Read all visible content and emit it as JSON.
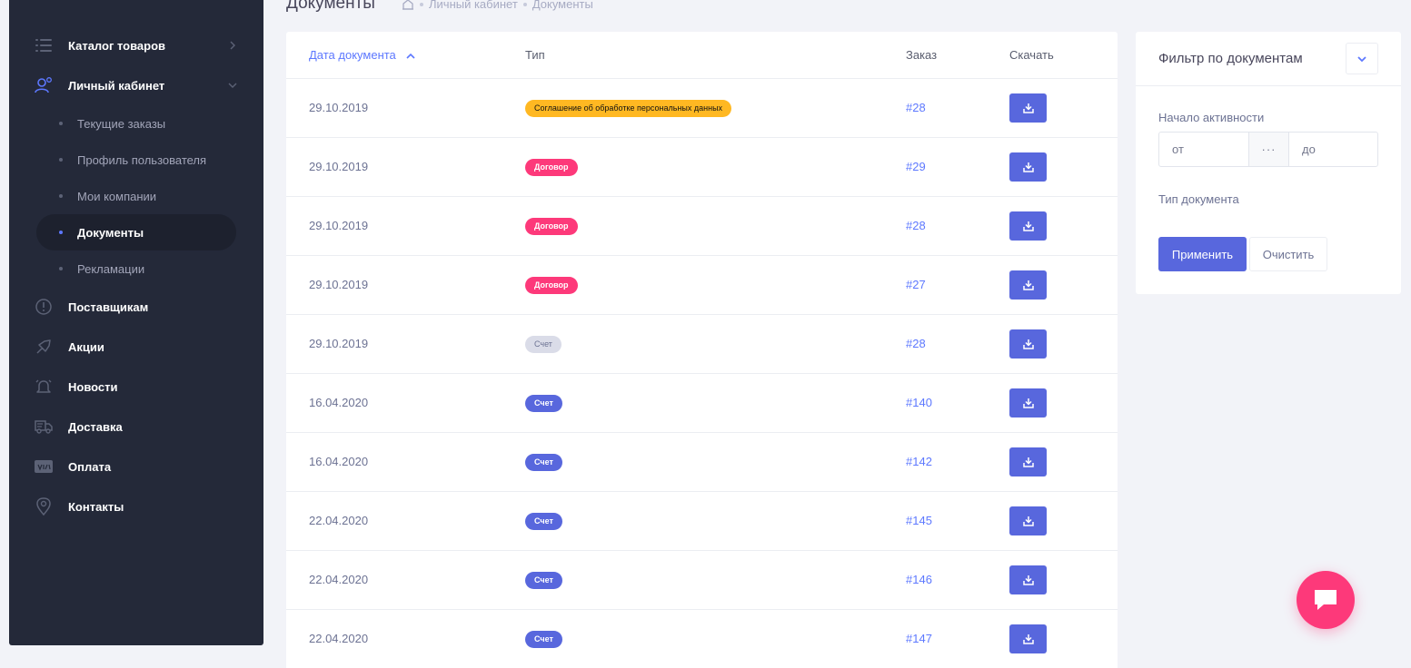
{
  "colors": {
    "sidebar_bg": "#242939",
    "accent": "#5867dd",
    "link": "#5d78ff",
    "warning": "#ffb822",
    "danger": "#fd397a",
    "page_bg": "#f2f3f8"
  },
  "sidebar": {
    "items": [
      {
        "label": "Каталог товаров",
        "icon": "list-icon",
        "chevron": "chevron-right-icon"
      },
      {
        "label": "Личный кабинет",
        "icon": "user-cog-icon",
        "chevron": "chevron-down-icon"
      },
      {
        "label": "Поставщикам",
        "icon": "alert-circle-icon"
      },
      {
        "label": "Акции",
        "icon": "rocket-icon"
      },
      {
        "label": "Новости",
        "icon": "bell-icon"
      },
      {
        "label": "Доставка",
        "icon": "truck-icon"
      },
      {
        "label": "Оплата",
        "icon": "visa-card-icon"
      },
      {
        "label": "Контакты",
        "icon": "map-marker-icon"
      }
    ],
    "subitems": [
      {
        "label": "Текущие заказы",
        "active": false
      },
      {
        "label": "Профиль пользователя",
        "active": false
      },
      {
        "label": "Мои компании",
        "active": false
      },
      {
        "label": "Документы",
        "active": true
      },
      {
        "label": "Рекламации",
        "active": false
      }
    ]
  },
  "header": {
    "title": "Документы",
    "breadcrumbs": [
      "Личный кабинет",
      "Документы"
    ],
    "home_icon": "home-icon"
  },
  "table": {
    "columns": {
      "date": "Дата документа",
      "type": "Тип",
      "order": "Заказ",
      "download": "Скачать"
    },
    "sort_icon": "sort-asc-icon",
    "rows": [
      {
        "date": "29.10.2019",
        "type": "Соглашение об обработке персональных данных",
        "badge": "yellow",
        "order": "#28"
      },
      {
        "date": "29.10.2019",
        "type": "Договор",
        "badge": "pink",
        "order": "#29"
      },
      {
        "date": "29.10.2019",
        "type": "Договор",
        "badge": "pink",
        "order": "#28"
      },
      {
        "date": "29.10.2019",
        "type": "Договор",
        "badge": "pink",
        "order": "#27"
      },
      {
        "date": "29.10.2019",
        "type": "Счет",
        "badge": "grey",
        "order": "#28"
      },
      {
        "date": "16.04.2020",
        "type": "Счет",
        "badge": "blue",
        "order": "#140"
      },
      {
        "date": "16.04.2020",
        "type": "Счет",
        "badge": "blue",
        "order": "#142"
      },
      {
        "date": "22.04.2020",
        "type": "Счет",
        "badge": "blue",
        "order": "#145"
      },
      {
        "date": "22.04.2020",
        "type": "Счет",
        "badge": "blue",
        "order": "#146"
      },
      {
        "date": "22.04.2020",
        "type": "Счет",
        "badge": "blue",
        "order": "#147"
      }
    ]
  },
  "filter": {
    "title": "Фильтр по документам",
    "activity_label": "Начало активности",
    "from_placeholder": "от",
    "to_placeholder": "до",
    "range_separator": "···",
    "doc_type_label": "Тип документа",
    "apply_label": "Применить",
    "clear_label": "Очистить"
  },
  "chat": {
    "icon": "chat-icon"
  }
}
